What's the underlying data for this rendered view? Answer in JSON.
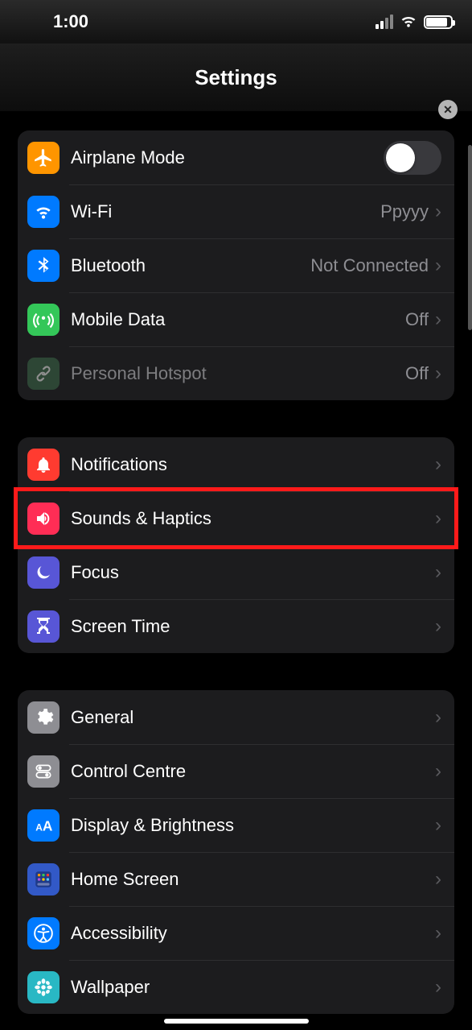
{
  "status": {
    "time": "1:00"
  },
  "header": {
    "title": "Settings"
  },
  "group1": [
    {
      "label": "Airplane Mode",
      "kind": "toggle",
      "icon": "airplane",
      "bg": "#ff9500"
    },
    {
      "label": "Wi-Fi",
      "value": "Ppyyy",
      "icon": "wifi",
      "bg": "#007aff"
    },
    {
      "label": "Bluetooth",
      "value": "Not Connected",
      "icon": "bluetooth",
      "bg": "#007aff"
    },
    {
      "label": "Mobile Data",
      "value": "Off",
      "icon": "antenna",
      "bg": "#34c759"
    },
    {
      "label": "Personal Hotspot",
      "value": "Off",
      "icon": "link",
      "bg": "#2f7a45",
      "dim": true
    }
  ],
  "group2": [
    {
      "label": "Notifications",
      "icon": "bell",
      "bg": "#ff3b30"
    },
    {
      "label": "Sounds & Haptics",
      "icon": "speaker",
      "bg": "#ff2d55",
      "highlight": true
    },
    {
      "label": "Focus",
      "icon": "moon",
      "bg": "#5856d6"
    },
    {
      "label": "Screen Time",
      "icon": "hourglass",
      "bg": "#5856d6"
    }
  ],
  "group3": [
    {
      "label": "General",
      "icon": "gear",
      "bg": "#8e8e93"
    },
    {
      "label": "Control Centre",
      "icon": "switches",
      "bg": "#8e8e93"
    },
    {
      "label": "Display & Brightness",
      "icon": "aa",
      "bg": "#007aff"
    },
    {
      "label": "Home Screen",
      "icon": "grid",
      "bg": "#3259c7"
    },
    {
      "label": "Accessibility",
      "icon": "person",
      "bg": "#007aff"
    },
    {
      "label": "Wallpaper",
      "icon": "flower",
      "bg": "#29b8c4"
    }
  ]
}
